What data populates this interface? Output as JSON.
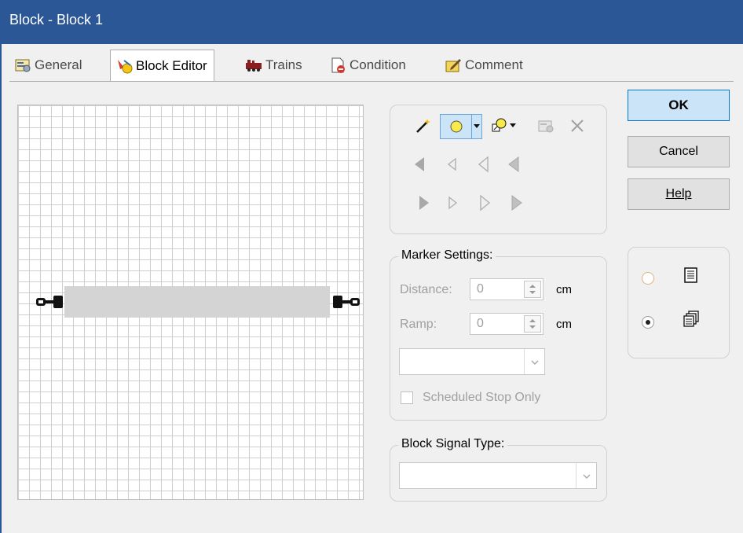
{
  "window": {
    "title": "Block - Block 1"
  },
  "tabs": [
    {
      "label": "General",
      "icon": "general-settings-icon",
      "active": false
    },
    {
      "label": "Block Editor",
      "icon": "block-editor-icon",
      "active": true
    },
    {
      "label": "Trains",
      "icon": "trains-icon",
      "active": false
    },
    {
      "label": "Condition",
      "icon": "condition-icon",
      "active": false
    },
    {
      "label": "Comment",
      "icon": "comment-icon",
      "active": false
    }
  ],
  "toolbar": {
    "tools": [
      "magic-wand-icon",
      "circle-marker-icon",
      "dropdown-arrow-icon",
      "marker-shape-icon",
      "dropdown-arrow-icon",
      "properties-icon",
      "delete-icon"
    ]
  },
  "marker_settings": {
    "title": "Marker Settings:",
    "distance_label": "Distance:",
    "distance_value": "0",
    "distance_unit": "cm",
    "ramp_label": "Ramp:",
    "ramp_value": "0",
    "ramp_unit": "cm",
    "combo_value": "",
    "scheduled_stop_label": "Scheduled Stop Only",
    "scheduled_stop_checked": false
  },
  "block_signal": {
    "title": "Block Signal Type:",
    "value": ""
  },
  "buttons": {
    "ok": "OK",
    "cancel": "Cancel",
    "help": "Help"
  },
  "view_options": [
    {
      "icon": "list-view-icon",
      "selected": false
    },
    {
      "icon": "stacked-view-icon",
      "selected": true
    }
  ],
  "colors": {
    "titlebar": "#2b5797",
    "ok_border": "#0078d7",
    "ok_bg": "#cce4f7"
  }
}
